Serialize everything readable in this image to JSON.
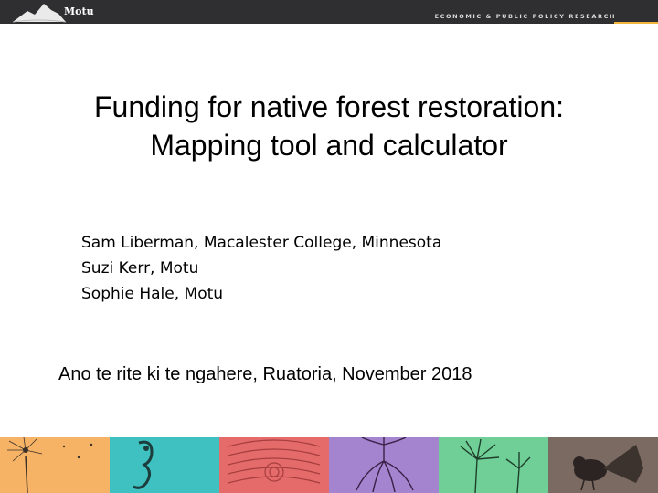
{
  "header": {
    "logo_name": "Motu",
    "tagline": "ECONOMIC & PUBLIC POLICY RESEARCH",
    "bar_color": "#2f2f31"
  },
  "title": {
    "line1": "Funding for native forest restoration:",
    "line2": "Mapping tool and calculator"
  },
  "authors": [
    "Sam Liberman, Macalester College, Minnesota",
    "Suzi Kerr, Motu",
    "Sophie Hale, Motu"
  ],
  "event": "Ano te rite ki te ngahere, Ruatoria, November 2018",
  "footer": {
    "panels": [
      {
        "icon": "dandelion-icon",
        "color": "#f6b365"
      },
      {
        "icon": "seahorse-icon",
        "color": "#3ec1c0"
      },
      {
        "icon": "carving-pattern-icon",
        "color": "#e56b6b"
      },
      {
        "icon": "tree-roots-icon",
        "color": "#a483cf"
      },
      {
        "icon": "cabbage-tree-icon",
        "color": "#6fcf97"
      },
      {
        "icon": "fantail-bird-icon",
        "color": "#7a6a62"
      }
    ]
  }
}
